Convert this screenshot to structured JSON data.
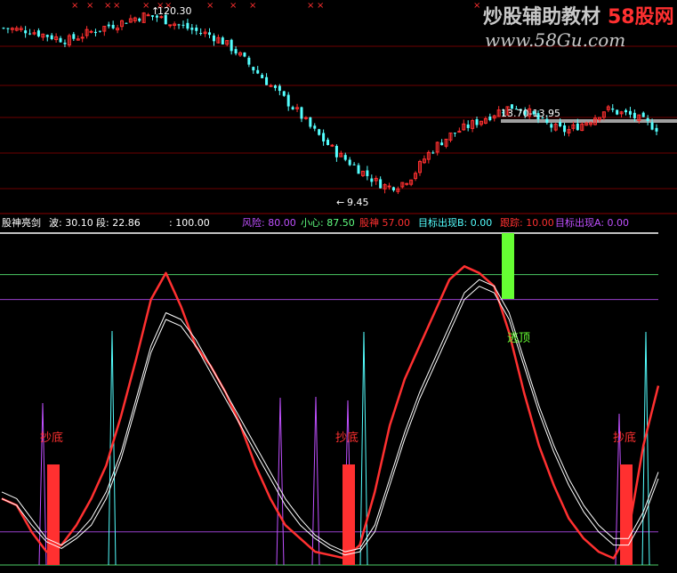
{
  "watermark": {
    "title": "炒股辅助教材",
    "brand": "58股网",
    "url": "www.58Gu.com",
    "colors": {
      "title": "#c8c8c8",
      "brand": "#ff3030",
      "url": "#c8c8c8"
    }
  },
  "price_panel": {
    "high_label": "120.30",
    "low_label": "9.45",
    "range_label": "13.70-13.95",
    "colors": {
      "up": "#ff3030",
      "down": "#54ffff",
      "grid": "#6e0000",
      "range_line": "#a0a0a0",
      "text": "#ffffff"
    }
  },
  "indicator_header": {
    "name": "股神亮剑",
    "items": [
      {
        "label": "波:",
        "value": "30.10",
        "color": "#ffffff"
      },
      {
        "label": "段:",
        "value": "22.86",
        "color": "#ffffff"
      },
      {
        "label": ":",
        "value": "100.00",
        "color": "#ffffff"
      },
      {
        "label": "",
        "value": "",
        "color": "#3050ff"
      },
      {
        "label": "风险:",
        "value": "80.00",
        "color": "#c050ff"
      },
      {
        "label": "小心:",
        "value": "87.50",
        "color": "#60ff80"
      },
      {
        "label": "股神",
        "value": "57.00",
        "color": "#ff3030"
      },
      {
        "label": "目标出现B:",
        "value": "0.00",
        "color": "#54ffff"
      },
      {
        "label": "跟踪:",
        "value": "10.00",
        "color": "#ff3030"
      },
      {
        "label": "目标出现A:",
        "value": "0.00",
        "color": "#c050ff"
      }
    ]
  },
  "signals": {
    "buy_label": "抄底",
    "escape_label": "逃顶",
    "buy_color": "#ff3030",
    "escape_color": "#66ff33"
  },
  "chart_data": [
    {
      "type": "candlestick",
      "title": "",
      "annotations": [
        "120.30",
        "9.45",
        "13.70-13.95"
      ],
      "high_value": 120.3,
      "low_value": 9.45,
      "range_band": [
        13.7,
        13.95
      ],
      "close_trend": [
        112,
        111,
        110.5,
        108,
        106,
        104,
        107,
        110,
        113,
        115,
        118,
        120,
        119,
        116,
        113,
        110,
        108,
        104,
        98,
        90,
        82,
        74,
        66,
        58,
        48,
        40,
        32,
        26,
        20,
        14,
        10,
        12,
        18,
        30,
        38,
        44,
        48,
        52,
        56,
        60,
        62,
        58,
        52,
        48,
        46,
        50,
        54,
        60,
        58,
        56,
        52,
        48
      ]
    },
    {
      "type": "line",
      "title": "",
      "ylim": [
        0,
        100
      ],
      "reference_lines": [
        100,
        80,
        87.5,
        10,
        0
      ],
      "series": [
        {
          "color": "#ff3030",
          "values": [
            20,
            18,
            10,
            4,
            6,
            12,
            20,
            30,
            45,
            62,
            80,
            88,
            78,
            66,
            60,
            52,
            42,
            30,
            20,
            12,
            8,
            4,
            3,
            2,
            6,
            22,
            42,
            56,
            66,
            76,
            86,
            90,
            88,
            84,
            70,
            52,
            36,
            24,
            14,
            8,
            4,
            2,
            10,
            36,
            54
          ]
        },
        {
          "color": "#ffffff",
          "values": [
            22,
            20,
            14,
            8,
            6,
            9,
            14,
            22,
            34,
            50,
            66,
            76,
            74,
            68,
            60,
            52,
            44,
            36,
            28,
            20,
            14,
            9,
            6,
            4,
            5,
            12,
            26,
            40,
            52,
            62,
            72,
            82,
            86,
            84,
            76,
            62,
            48,
            36,
            26,
            18,
            12,
            8,
            8,
            16,
            28
          ]
        },
        {
          "color": "#ffffff",
          "values": [
            20,
            18,
            12,
            7,
            5,
            8,
            12,
            20,
            32,
            48,
            64,
            74,
            72,
            66,
            58,
            50,
            42,
            34,
            26,
            18,
            12,
            8,
            5,
            3,
            4,
            10,
            24,
            38,
            50,
            60,
            70,
            80,
            84,
            82,
            74,
            60,
            46,
            34,
            24,
            16,
            10,
            6,
            6,
            14,
            26
          ]
        }
      ],
      "buy_signals": [
        "抄底",
        "抄底",
        "抄底"
      ],
      "escape_signals": [
        "逃顶"
      ]
    }
  ]
}
